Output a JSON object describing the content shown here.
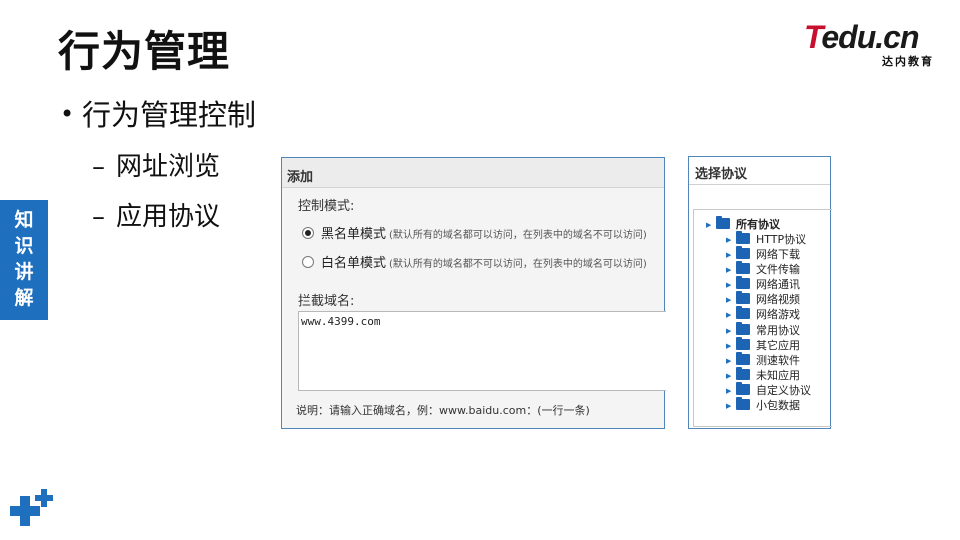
{
  "slide": {
    "title": "行为管理",
    "bullet": "行为管理控制",
    "sub_items": [
      "网址浏览",
      "应用协议"
    ],
    "side_tab": [
      "知",
      "识",
      "讲",
      "解"
    ],
    "logo": {
      "main": "Tedu.cn",
      "sub": "达内教育"
    }
  },
  "add_panel": {
    "header": "添加",
    "mode_label": "控制模式:",
    "blacklist": {
      "label": "黑名单模式",
      "hint": "(默认所有的域名都可以访问，在列表中的域名不可以访问)",
      "checked": true
    },
    "whitelist": {
      "label": "白名单模式",
      "hint": "(默认所有的域名都不可以访问，在列表中的域名可以访问)",
      "checked": false
    },
    "domain_label": "拦截域名:",
    "domain_value": "www.4399.com",
    "note": "说明：请输入正确域名，例：www.baidu.com：(一行一条)"
  },
  "protocol_panel": {
    "header": "选择协议",
    "root": "所有协议",
    "items": [
      "HTTP协议",
      "网络下载",
      "文件传输",
      "网络通讯",
      "网络视频",
      "网络游戏",
      "常用协议",
      "其它应用",
      "测速软件",
      "未知应用",
      "自定义协议",
      "小包数据"
    ]
  },
  "colors": {
    "accent": "#1f6fbf",
    "logo_red": "#c8102e",
    "panel_border": "#4f87b8"
  }
}
